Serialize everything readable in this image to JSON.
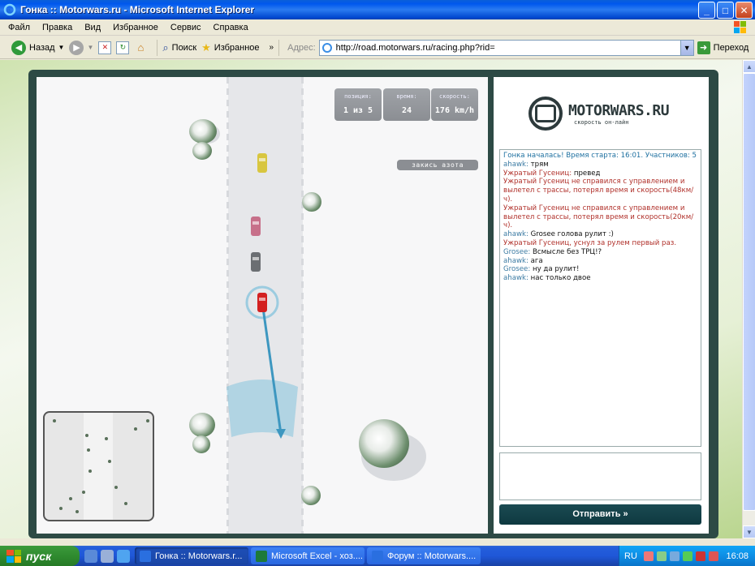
{
  "window": {
    "title": "Гонка :: Motorwars.ru - Microsoft Internet Explorer",
    "buttons": {
      "minimize": "_",
      "maximize": "□",
      "close": "✕"
    }
  },
  "menu": [
    "Файл",
    "Правка",
    "Вид",
    "Избранное",
    "Сервис",
    "Справка"
  ],
  "toolbar": {
    "back_label": "Назад",
    "search_label": "Поиск",
    "favorites_label": "Избранное",
    "address_label": "Адрес:",
    "address_value": "http://road.motorwars.ru/racing.php?rid=",
    "go_label": "Переход"
  },
  "hud": {
    "position_label": "позиция:",
    "position_value": "1 из 5",
    "time_label": "время:",
    "time_value": "24",
    "speed_label": "скорость:",
    "speed_value": "176 km/h",
    "nitro_label": "закись азота"
  },
  "logo": {
    "brand": "MOTORWARS.RU",
    "slogan": "скорость он-лайн"
  },
  "chat": [
    {
      "type": "sys",
      "text": "Гонка началась! Время старта: 16:01. Участников: 5"
    },
    {
      "type": "msg",
      "nick": "ahawk:",
      "text": "трям"
    },
    {
      "type": "msg2",
      "nick": "Ужратый Гусениц:",
      "text": "превед"
    },
    {
      "type": "warn",
      "text": "Ужратый Гусениц не справился с управлением и вылетел с трассы, потерял время и скорость(48км/ч)."
    },
    {
      "type": "warn",
      "text": "Ужратый Гусениц не справился с управлением и вылетел с трассы, потерял время и скорость(20км/ч)."
    },
    {
      "type": "msg",
      "nick": "ahawk:",
      "text": "Grosee голова рулит :)"
    },
    {
      "type": "warn",
      "text": "Ужратый Гусениц, уснул за рулем первый раз."
    },
    {
      "type": "msg",
      "nick": "Grosee:",
      "text": "Всмысле без ТРЦ!?"
    },
    {
      "type": "msg",
      "nick": "ahawk:",
      "text": "ага"
    },
    {
      "type": "msg",
      "nick": "Grosee:",
      "text": "ну да рулит!"
    },
    {
      "type": "msg",
      "nick": "ahawk:",
      "text": "нас только двое"
    }
  ],
  "send_button": "Отправить »",
  "taskbar": {
    "start": "пуск",
    "tasks": [
      {
        "label": "Гонка :: Motorwars.r...",
        "active": true,
        "icon_color": "#2a6fe0"
      },
      {
        "label": "Microsoft Excel - хоз....",
        "active": false,
        "icon_color": "#1d7a3a"
      },
      {
        "label": "Форум :: Motorwars....",
        "active": false,
        "icon_color": "#2a6fe0"
      }
    ],
    "lang": "RU",
    "clock": "16:08"
  },
  "colors": {
    "accent_dark": "#2d4a45",
    "player_car": "#d32020",
    "car_yellow": "#d8c640",
    "car_pink": "#c7708a",
    "car_grey": "#6b6e72",
    "steer_arc": "#7cc1dc"
  }
}
